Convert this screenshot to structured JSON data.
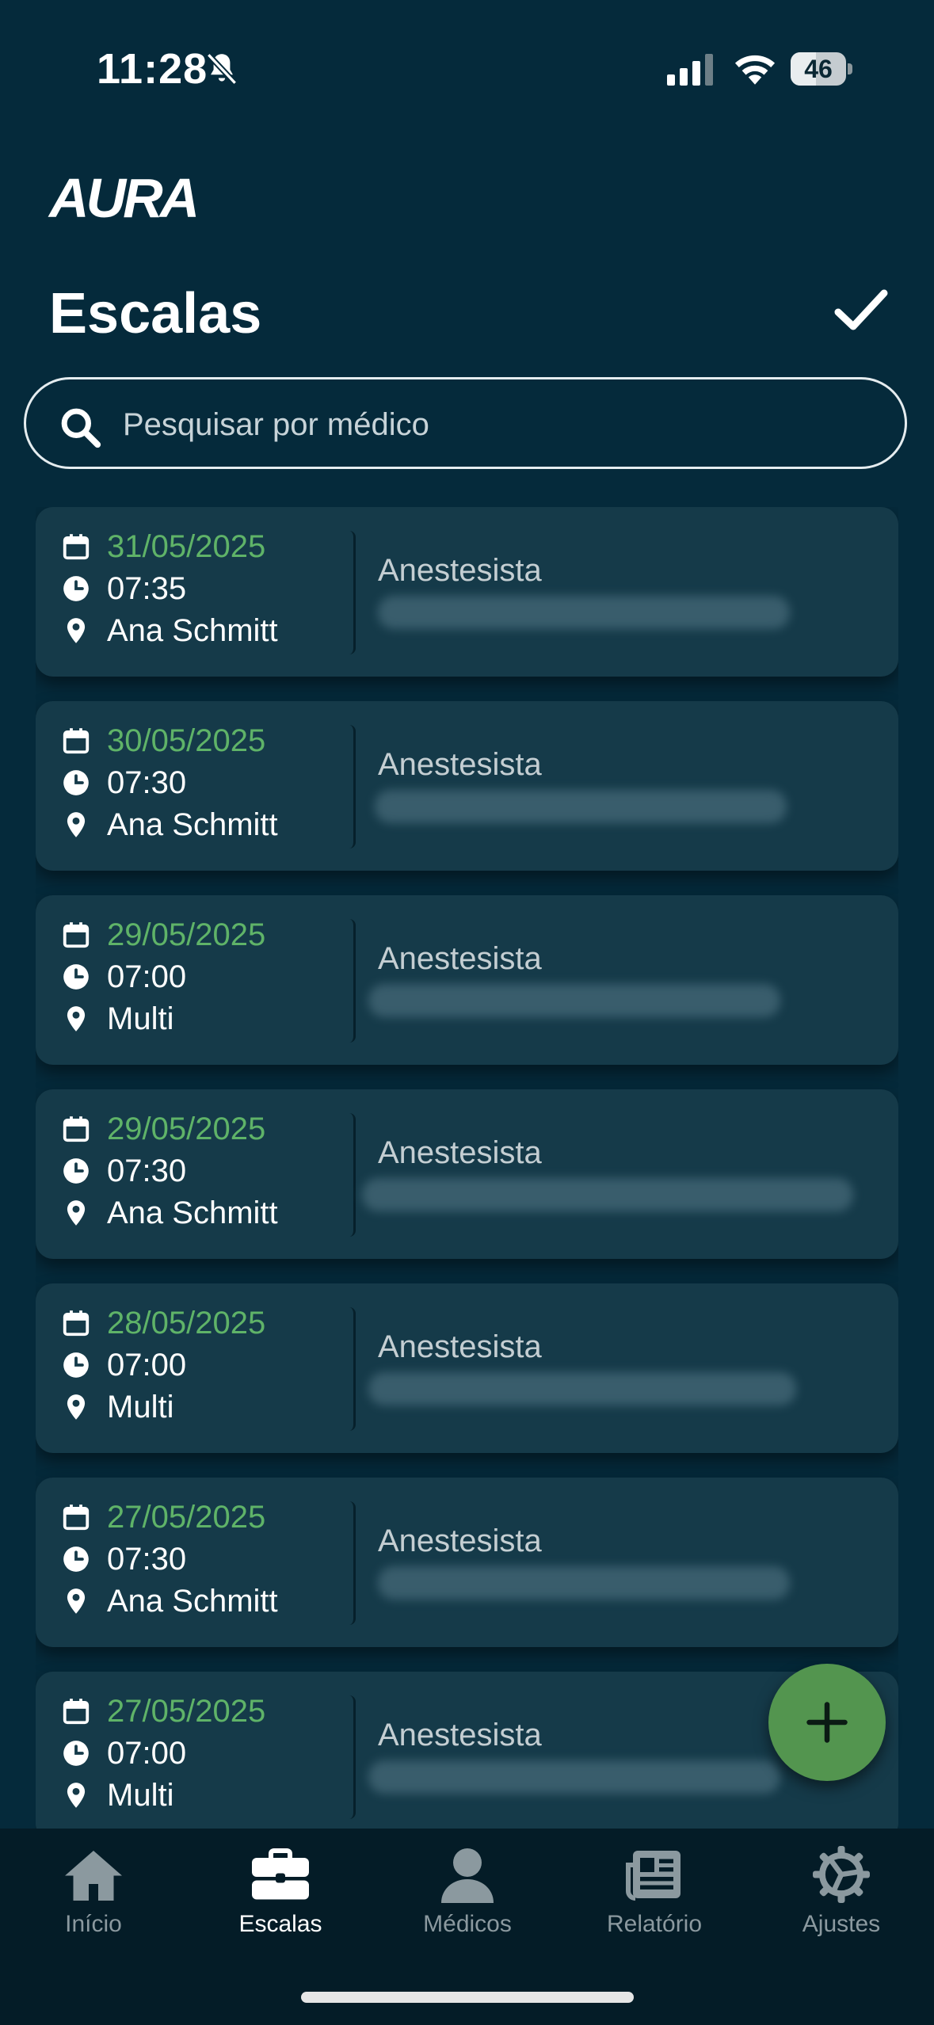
{
  "status_bar": {
    "time": "11:28",
    "battery": "46",
    "battery_level": 0.46
  },
  "logo": "AURA",
  "header": {
    "title": "Escalas"
  },
  "search": {
    "placeholder": "Pesquisar por médico"
  },
  "schedules": [
    {
      "date": "31/05/2025",
      "time": "07:35",
      "location": "Ana Schmitt",
      "role": "Anestesista"
    },
    {
      "date": "30/05/2025",
      "time": "07:30",
      "location": "Ana Schmitt",
      "role": "Anestesista"
    },
    {
      "date": "29/05/2025",
      "time": "07:00",
      "location": "Multi",
      "role": "Anestesista"
    },
    {
      "date": "29/05/2025",
      "time": "07:30",
      "location": "Ana Schmitt",
      "role": "Anestesista"
    },
    {
      "date": "28/05/2025",
      "time": "07:00",
      "location": "Multi",
      "role": "Anestesista"
    },
    {
      "date": "27/05/2025",
      "time": "07:30",
      "location": "Ana Schmitt",
      "role": "Anestesista"
    },
    {
      "date": "27/05/2025",
      "time": "07:00",
      "location": "Multi",
      "role": "Anestesista"
    }
  ],
  "tabs": [
    {
      "label": "Início",
      "icon": "home-icon"
    },
    {
      "label": "Escalas",
      "icon": "briefcase-icon",
      "active": true
    },
    {
      "label": "Médicos",
      "icon": "person-icon"
    },
    {
      "label": "Relatório",
      "icon": "newspaper-icon"
    },
    {
      "label": "Ajustes",
      "icon": "gear-icon"
    }
  ],
  "colors": {
    "background": "#052a3b",
    "card": "#153a49",
    "date_green": "#5fb368",
    "fab": "#53954f",
    "tab_bar": "#041c27"
  }
}
